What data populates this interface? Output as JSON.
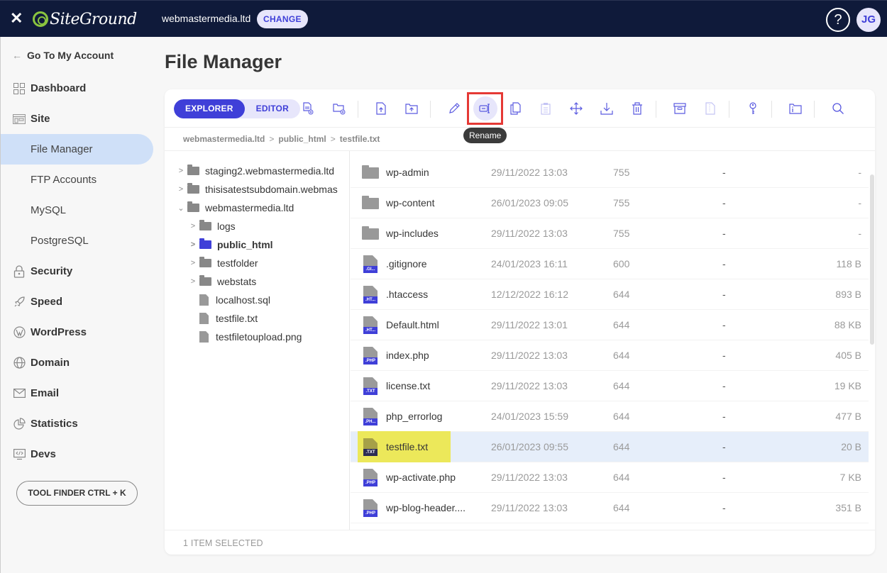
{
  "topbar": {
    "brand": "SiteGround",
    "site_name": "webmastermedia.ltd",
    "change_label": "CHANGE",
    "help_glyph": "?",
    "avatar_initials": "JG",
    "close_glyph": "✕"
  },
  "sidebar": {
    "back_label": "Go To My Account",
    "items": [
      {
        "label": "Dashboard",
        "icon": "grid-icon"
      },
      {
        "label": "Site",
        "icon": "site-icon"
      },
      {
        "label": "File Manager",
        "sub": true,
        "active": true
      },
      {
        "label": "FTP Accounts",
        "sub": true
      },
      {
        "label": "MySQL",
        "sub": true
      },
      {
        "label": "PostgreSQL",
        "sub": true
      },
      {
        "label": "Security",
        "icon": "lock-icon"
      },
      {
        "label": "Speed",
        "icon": "rocket-icon"
      },
      {
        "label": "WordPress",
        "icon": "wordpress-icon"
      },
      {
        "label": "Domain",
        "icon": "globe-icon"
      },
      {
        "label": "Email",
        "icon": "envelope-icon"
      },
      {
        "label": "Statistics",
        "icon": "pie-chart-icon"
      },
      {
        "label": "Devs",
        "icon": "code-icon"
      }
    ],
    "tool_finder_label": "TOOL FINDER CTRL + K"
  },
  "page": {
    "title": "File Manager"
  },
  "toolbar": {
    "tabs": [
      {
        "label": "EXPLORER",
        "active": true
      },
      {
        "label": "EDITOR",
        "active": false
      }
    ],
    "buttons": [
      {
        "name": "new-file",
        "icon": "new-file-icon"
      },
      {
        "name": "new-folder",
        "icon": "new-folder-icon"
      },
      {
        "name": "upload-file",
        "icon": "upload-file-icon"
      },
      {
        "name": "upload-folder",
        "icon": "upload-folder-icon"
      },
      {
        "name": "edit",
        "icon": "pencil-icon"
      },
      {
        "name": "rename",
        "icon": "rename-icon",
        "hovered": true
      },
      {
        "name": "copy",
        "icon": "copy-icon"
      },
      {
        "name": "paste",
        "icon": "clipboard-icon",
        "disabled": true
      },
      {
        "name": "move",
        "icon": "move-icon"
      },
      {
        "name": "download",
        "icon": "download-icon"
      },
      {
        "name": "delete",
        "icon": "trash-icon"
      },
      {
        "name": "archive",
        "icon": "archive-icon"
      },
      {
        "name": "extract",
        "icon": "zip-file-icon",
        "disabled": true
      },
      {
        "name": "permissions",
        "icon": "key-icon"
      },
      {
        "name": "folder-info",
        "icon": "folder-info-icon"
      },
      {
        "name": "search",
        "icon": "search-icon"
      }
    ],
    "tooltip": "Rename"
  },
  "breadcrumb": [
    "webmastermedia.ltd",
    "public_html",
    "testfile.txt"
  ],
  "breadcrumb_sep": ">",
  "tree": [
    {
      "label": "staging2.webmastermedia.ltd",
      "type": "folder",
      "level": 0,
      "expanded": false
    },
    {
      "label": "thisisatestsubdomain.webmas",
      "type": "folder",
      "level": 0,
      "expanded": false
    },
    {
      "label": "webmastermedia.ltd",
      "type": "folder",
      "level": 0,
      "expanded": true
    },
    {
      "label": "logs",
      "type": "folder",
      "level": 1,
      "expanded": false
    },
    {
      "label": "public_html",
      "type": "folder",
      "level": 1,
      "expanded": false,
      "current": true
    },
    {
      "label": "testfolder",
      "type": "folder",
      "level": 1,
      "expanded": false
    },
    {
      "label": "webstats",
      "type": "folder",
      "level": 1,
      "expanded": false
    },
    {
      "label": "localhost.sql",
      "type": "file",
      "level": 1
    },
    {
      "label": "testfile.txt",
      "type": "file",
      "level": 1
    },
    {
      "label": "testfiletoupload.png",
      "type": "file",
      "level": 1
    }
  ],
  "files": [
    {
      "name": "wp-admin",
      "type": "folder",
      "modified": "29/11/2022 13:03",
      "perms": "755",
      "owner": "-",
      "size": "-"
    },
    {
      "name": "wp-content",
      "type": "folder",
      "modified": "26/01/2023 09:05",
      "perms": "755",
      "owner": "-",
      "size": "-"
    },
    {
      "name": "wp-includes",
      "type": "folder",
      "modified": "29/11/2022 13:03",
      "perms": "755",
      "owner": "-",
      "size": "-"
    },
    {
      "name": ".gitignore",
      "type": "file",
      "tag": ".GI...",
      "modified": "24/01/2023 16:11",
      "perms": "600",
      "owner": "-",
      "size": "118 B"
    },
    {
      "name": ".htaccess",
      "type": "file",
      "tag": ".HT...",
      "modified": "12/12/2022 16:12",
      "perms": "644",
      "owner": "-",
      "size": "893 B"
    },
    {
      "name": "Default.html",
      "type": "file",
      "tag": ".HT...",
      "modified": "29/11/2022 13:01",
      "perms": "644",
      "owner": "-",
      "size": "88 KB"
    },
    {
      "name": "index.php",
      "type": "file",
      "tag": ".PHP",
      "modified": "29/11/2022 13:03",
      "perms": "644",
      "owner": "-",
      "size": "405 B"
    },
    {
      "name": "license.txt",
      "type": "file",
      "tag": ".TXT",
      "modified": "29/11/2022 13:03",
      "perms": "644",
      "owner": "-",
      "size": "19 KB"
    },
    {
      "name": "php_errorlog",
      "type": "file",
      "tag": ".PH...",
      "modified": "24/01/2023 15:59",
      "perms": "644",
      "owner": "-",
      "size": "477 B"
    },
    {
      "name": "testfile.txt",
      "type": "file",
      "tag": ".TXT",
      "modified": "26/01/2023 09:55",
      "perms": "644",
      "owner": "-",
      "size": "20 B",
      "selected": true,
      "highlighted": true
    },
    {
      "name": "wp-activate.php",
      "type": "file",
      "tag": ".PHP",
      "modified": "29/11/2022 13:03",
      "perms": "644",
      "owner": "-",
      "size": "7 KB"
    },
    {
      "name": "wp-blog-header....",
      "type": "file",
      "tag": ".PHP",
      "modified": "29/11/2022 13:03",
      "perms": "644",
      "owner": "-",
      "size": "351 B"
    }
  ],
  "footer": {
    "status": "1 ITEM SELECTED"
  },
  "colors": {
    "accent": "#3f3fd8",
    "topbar_bg": "#0f1a3a",
    "brand_green": "#8ac43f",
    "selected_row": "#e6eefa",
    "active_nav": "#cfe0f8",
    "highlight_yellow": "#ece85a",
    "annotation_red": "#e53935"
  }
}
